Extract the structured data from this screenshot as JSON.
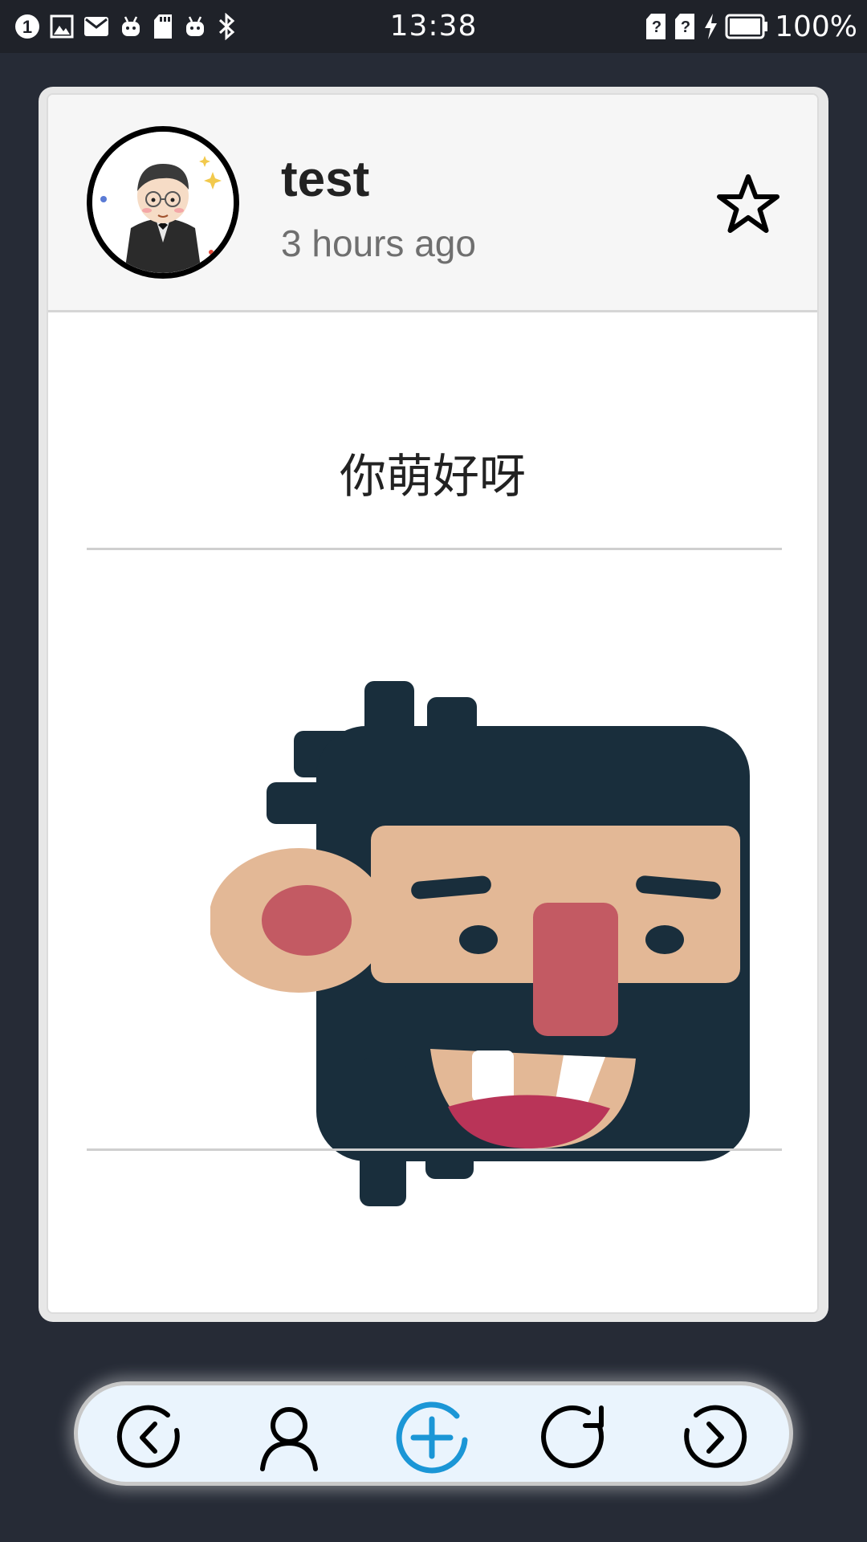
{
  "status_bar": {
    "time": "13:38",
    "battery_text": "100%",
    "left_icons": [
      "notification-count-icon",
      "gallery-icon",
      "mail-icon",
      "android-icon",
      "sd-card-icon",
      "android-icon",
      "bluetooth-icon"
    ],
    "notification_count": "1",
    "right_icons": [
      "sim-unknown-icon",
      "sim-unknown-icon",
      "charging-icon",
      "battery-icon"
    ]
  },
  "post": {
    "username": "test",
    "timestamp": "3 hours ago",
    "text": "你萌好呀",
    "favorite_icon": "star-outline-icon"
  },
  "bottom_nav": {
    "items": [
      {
        "name": "previous",
        "icon": "chevron-left-circle-icon"
      },
      {
        "name": "profile",
        "icon": "user-icon"
      },
      {
        "name": "add",
        "icon": "plus-circle-icon",
        "accent": "#1b96d6"
      },
      {
        "name": "refresh",
        "icon": "refresh-icon"
      },
      {
        "name": "next",
        "icon": "chevron-right-circle-icon"
      }
    ]
  },
  "colors": {
    "background": "#262b36",
    "status_bar": "#1f2229",
    "accent": "#1b96d6"
  }
}
